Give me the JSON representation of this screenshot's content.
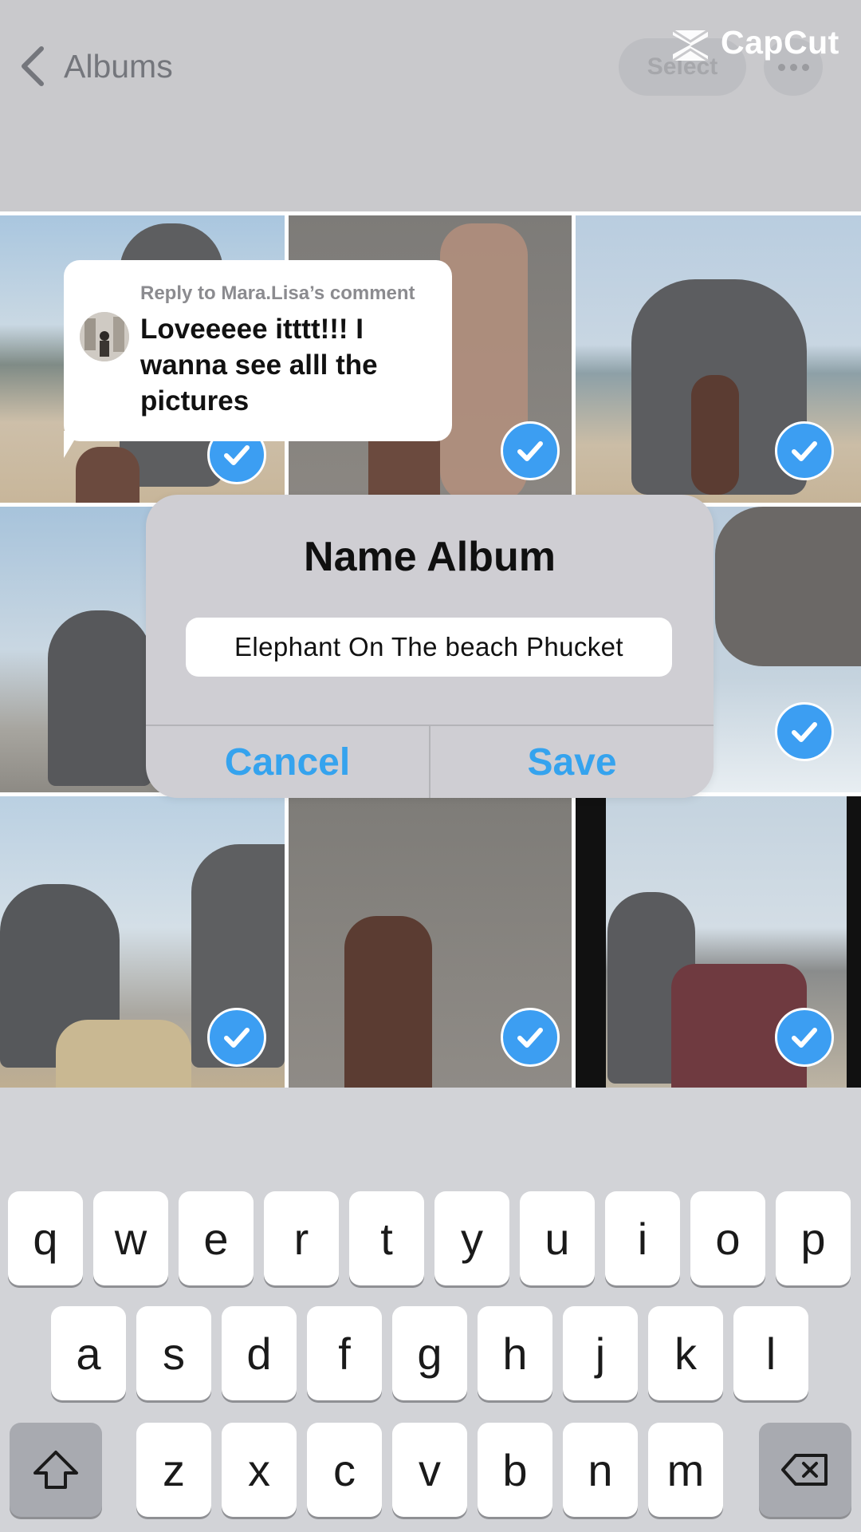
{
  "nav": {
    "back_label": "Albums",
    "select_label": "Select"
  },
  "watermark": {
    "brand": "CapCut"
  },
  "comment": {
    "reply_to": "Reply to Mara.Lisa’s comment",
    "text": "Loveeeee itttt!!! I wanna see alll the pictures"
  },
  "dialog": {
    "title": "Name Album",
    "input_value": "Elephant On The beach Phucket",
    "cancel_label": "Cancel",
    "save_label": "Save"
  },
  "photos": [
    {
      "desc": "woman by elephant on beach",
      "selected": true
    },
    {
      "desc": "elephant trunk close-up",
      "selected": true
    },
    {
      "desc": "woman hugging elephant",
      "selected": true
    },
    {
      "desc": "elephant on rocky shore",
      "selected": true
    },
    {
      "desc": "elephant head close-up",
      "selected": true
    },
    {
      "desc": "woman sitting on rock with elephants",
      "selected": true
    },
    {
      "desc": "woman beside elephant",
      "selected": true
    },
    {
      "desc": "three women with elephants",
      "selected": true
    }
  ],
  "keyboard": {
    "row1": [
      "q",
      "w",
      "e",
      "r",
      "t",
      "y",
      "u",
      "i",
      "o",
      "p"
    ],
    "row2": [
      "a",
      "s",
      "d",
      "f",
      "g",
      "h",
      "j",
      "k",
      "l"
    ],
    "row3": [
      "z",
      "x",
      "c",
      "v",
      "b",
      "n",
      "m"
    ]
  },
  "colors": {
    "accent": "#35a3ee",
    "check": "#3c9ef2",
    "keyboard_bg": "#d2d3d7"
  }
}
